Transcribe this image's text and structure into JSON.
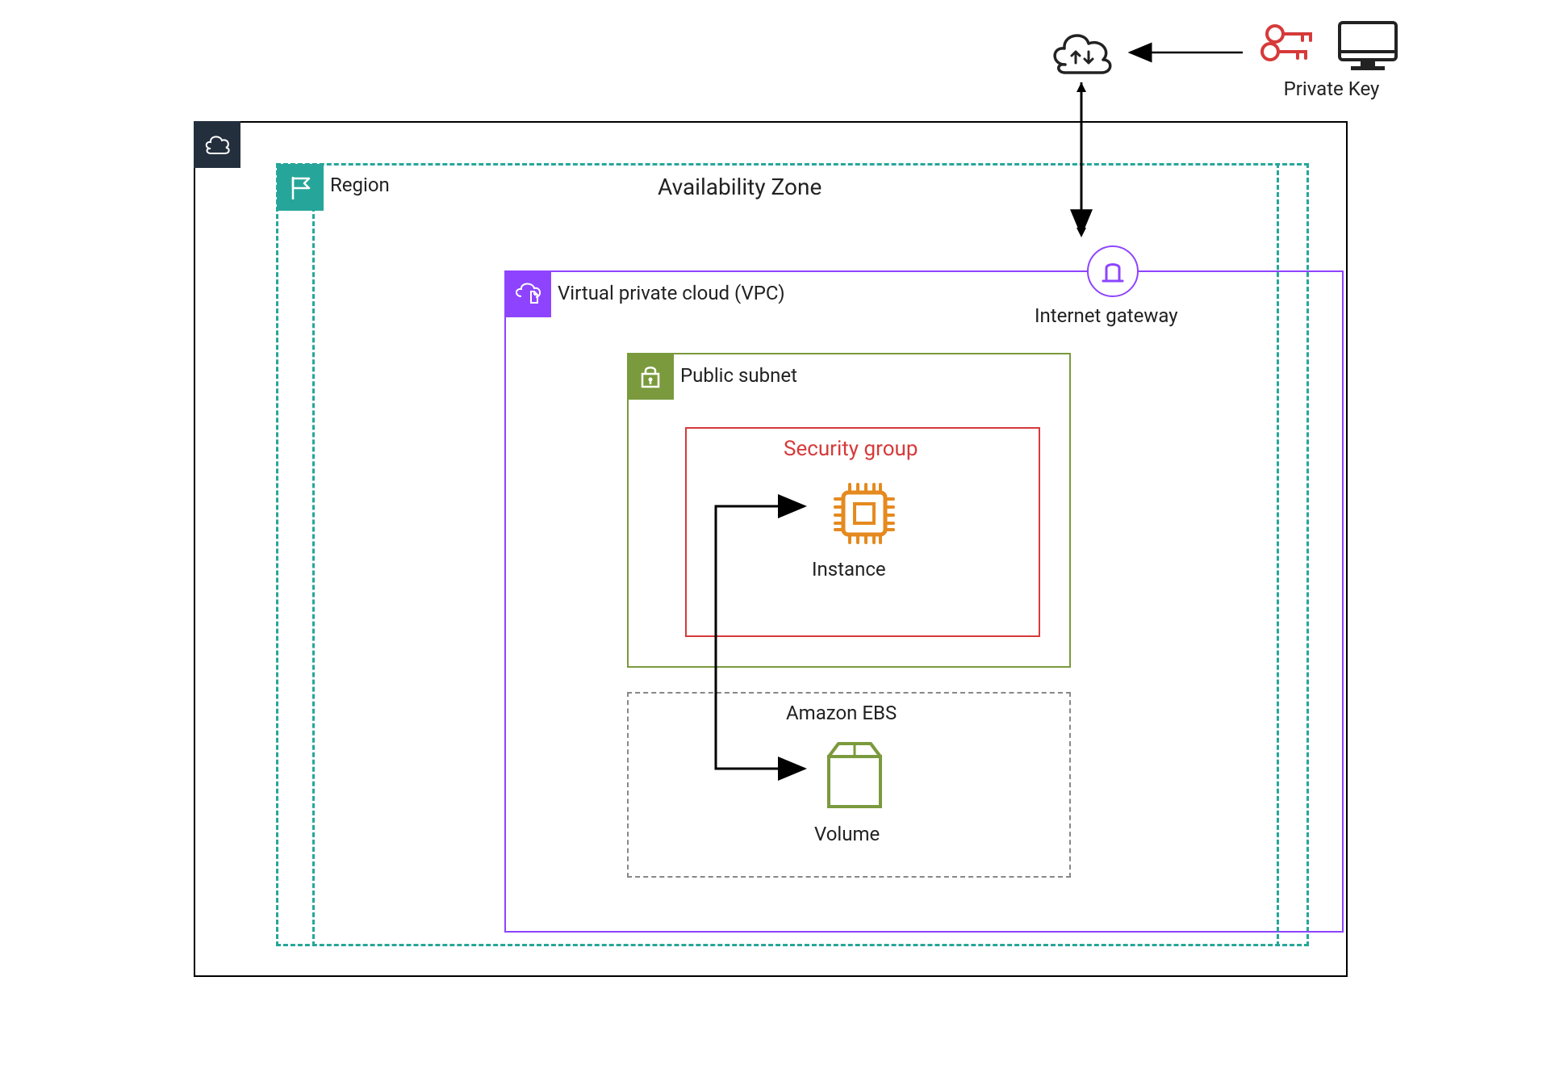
{
  "external": {
    "private_key_label": "Private Key"
  },
  "aws": {
    "region_label": "Region",
    "availability_zone_label": "Availability Zone",
    "vpc_label": "Virtual private cloud (VPC)",
    "internet_gateway_label": "Internet gateway",
    "public_subnet_label": "Public subnet",
    "security_group_label": "Security group",
    "instance_label": "Instance",
    "ebs_label": "Amazon EBS",
    "volume_label": "Volume"
  },
  "colors": {
    "aws_badge": "#242f3e",
    "region": "#26a69a",
    "vpc": "#8e44ff",
    "subnet": "#7a9a3d",
    "security_group": "#d63a3a",
    "instance": "#e58a1f",
    "ebs_border": "#888888",
    "private_key": "#d63a3a"
  }
}
